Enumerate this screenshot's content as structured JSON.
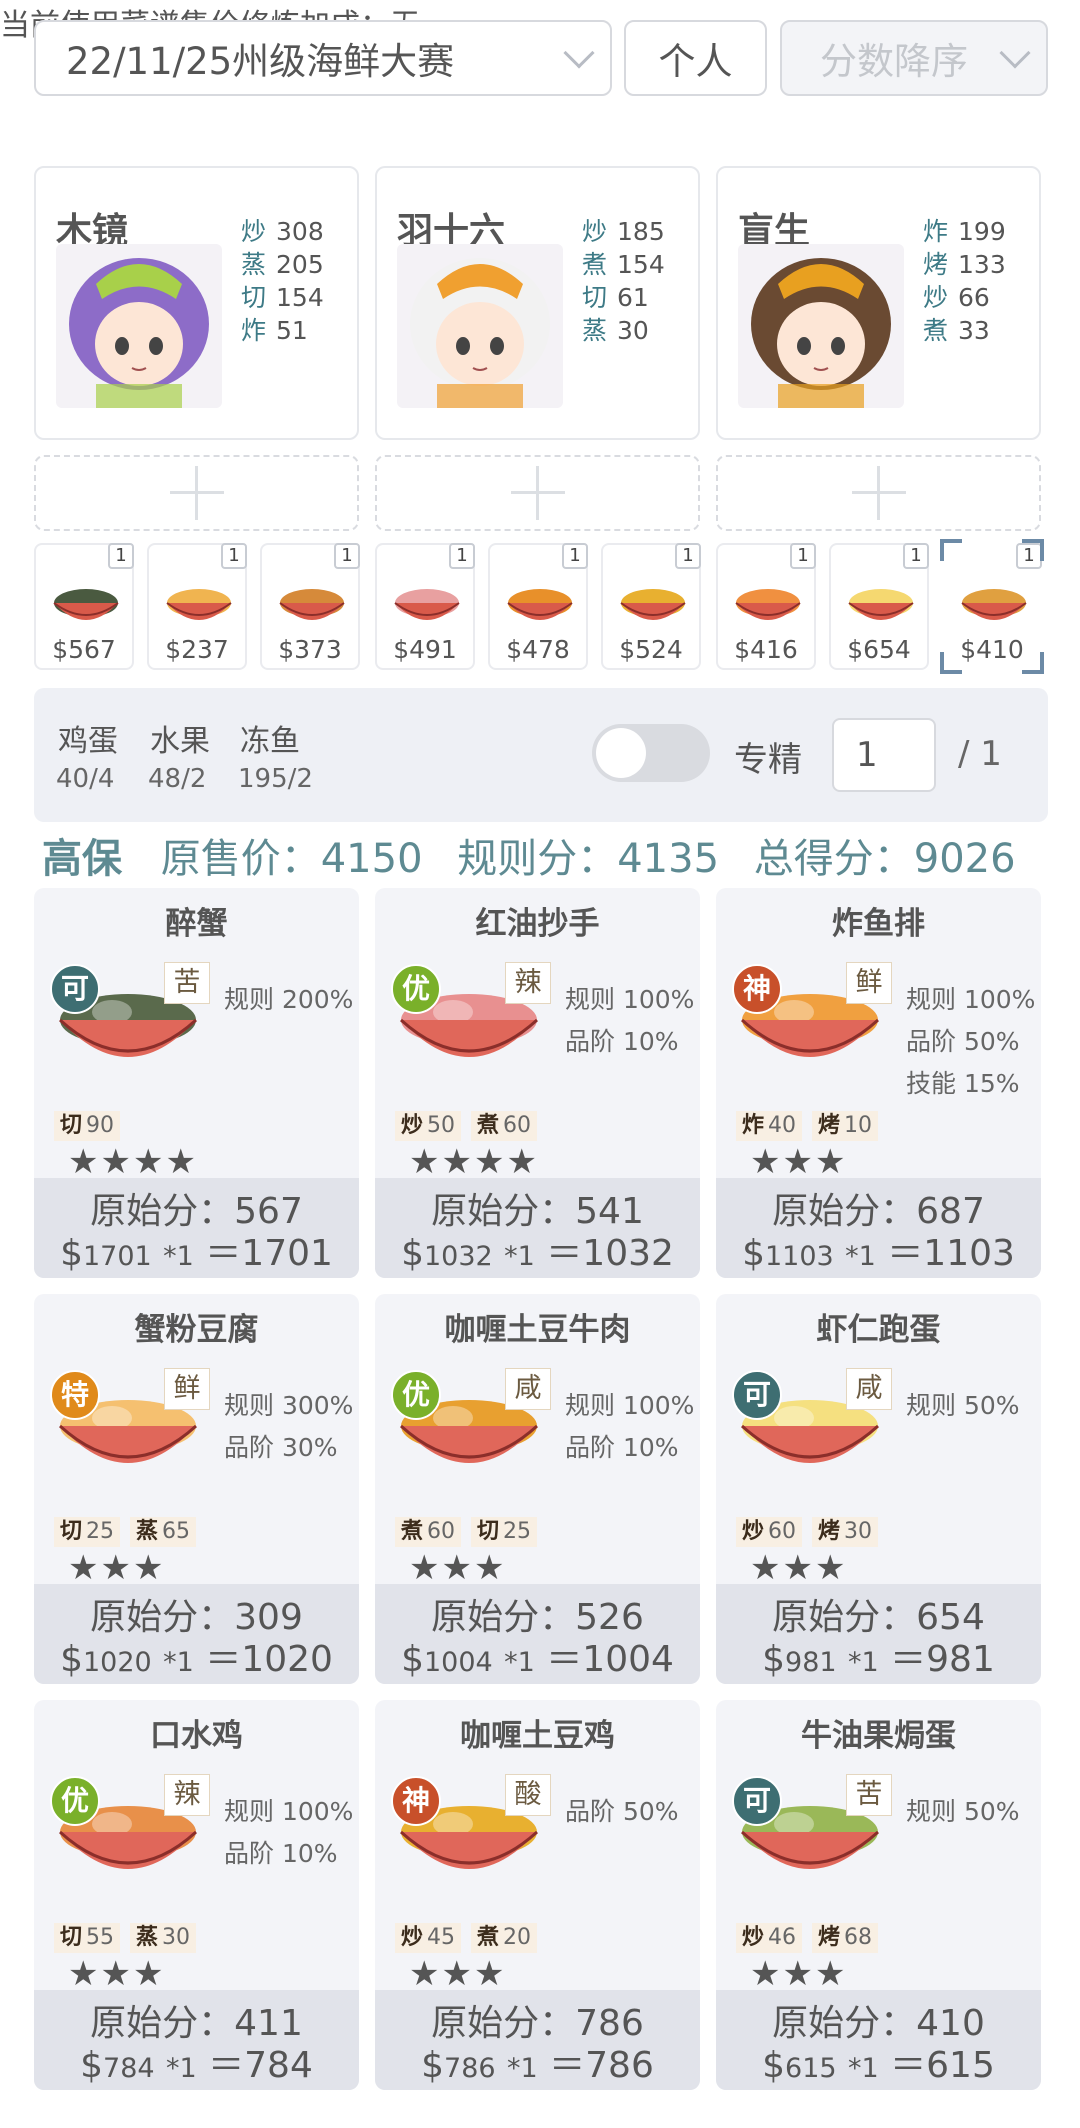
{
  "header": {
    "contest": "22/11/25州级海鲜大赛",
    "person_label": "个人",
    "sort_label": "分数降序",
    "bonus_text": "当前使用菜谱售价修炼加成：无"
  },
  "chefs": [
    {
      "name": "木镜",
      "skills": [
        {
          "k": "炒",
          "v": "308"
        },
        {
          "k": "蒸",
          "v": "205"
        },
        {
          "k": "切",
          "v": "154"
        },
        {
          "k": "炸",
          "v": "51"
        }
      ],
      "hair": "#8d6cc8",
      "accent": "#a8d04a"
    },
    {
      "name": "羽十六",
      "skills": [
        {
          "k": "炒",
          "v": "185"
        },
        {
          "k": "煮",
          "v": "154"
        },
        {
          "k": "切",
          "v": "61"
        },
        {
          "k": "蒸",
          "v": "30"
        }
      ],
      "hair": "#f2f2f2",
      "accent": "#f0a030"
    },
    {
      "name": "盲生",
      "skills": [
        {
          "k": "炸",
          "v": "199"
        },
        {
          "k": "烤",
          "v": "133"
        },
        {
          "k": "炒",
          "v": "66"
        },
        {
          "k": "煮",
          "v": "33"
        }
      ],
      "hair": "#6a4a32",
      "accent": "#e8a020"
    }
  ],
  "strip": [
    {
      "price": "$567",
      "qty": "1",
      "color": "#4a5a40"
    },
    {
      "price": "$237",
      "qty": "1",
      "color": "#f0b450"
    },
    {
      "price": "$373",
      "qty": "1",
      "color": "#d68a3a"
    },
    {
      "price": "$491",
      "qty": "1",
      "color": "#e8a0a0"
    },
    {
      "price": "$478",
      "qty": "1",
      "color": "#e8902a"
    },
    {
      "price": "$524",
      "qty": "1",
      "color": "#e8b030"
    },
    {
      "price": "$416",
      "qty": "1",
      "color": "#f09040"
    },
    {
      "price": "$654",
      "qty": "1",
      "color": "#f5d870"
    },
    {
      "price": "$410",
      "qty": "1",
      "color": "#e0a040"
    }
  ],
  "ingredients": [
    {
      "name": "鸡蛋",
      "value": "40/4"
    },
    {
      "name": "水果",
      "value": "48/2"
    },
    {
      "name": "冻鱼",
      "value": "195/2"
    }
  ],
  "spec": {
    "label": "专精",
    "value": "1",
    "total": "/ 1"
  },
  "score": {
    "level": "高保",
    "orig": "原售价：4150",
    "rule": "规则分：4135",
    "total": "总得分：9026"
  },
  "dishes": [
    {
      "title": "醉蟹",
      "grade": "可",
      "gcolor": "#3e6e72",
      "tag": "苦",
      "rules": [
        "规则 200%"
      ],
      "skills": [
        {
          "k": "切",
          "v": "90"
        }
      ],
      "stars": "★★★★",
      "raw": "原始分：567",
      "price": "1701",
      "mult": "*1",
      "total": "＝1701",
      "food": "#5a6a4c"
    },
    {
      "title": "红油抄手",
      "grade": "优",
      "gcolor": "#7ab02a",
      "tag": "辣",
      "rules": [
        "规则 100%",
        "品阶 10%"
      ],
      "skills": [
        {
          "k": "炒",
          "v": "50"
        },
        {
          "k": "煮",
          "v": "60"
        }
      ],
      "stars": "★★★★",
      "raw": "原始分：541",
      "price": "1032",
      "mult": "*1",
      "total": "＝1032",
      "food": "#e89090"
    },
    {
      "title": "炸鱼排",
      "grade": "神",
      "gcolor": "#c8502a",
      "tag": "鲜",
      "rules": [
        "规则 100%",
        "品阶 50%",
        "技能 15%"
      ],
      "skills": [
        {
          "k": "炸",
          "v": "40"
        },
        {
          "k": "烤",
          "v": "10"
        }
      ],
      "stars": "★★★",
      "raw": "原始分：687",
      "price": "1103",
      "mult": "*1",
      "total": "＝1103",
      "food": "#f0a040"
    },
    {
      "title": "蟹粉豆腐",
      "grade": "特",
      "gcolor": "#e08a1a",
      "tag": "鲜",
      "rules": [
        "规则 300%",
        "品阶 30%"
      ],
      "skills": [
        {
          "k": "切",
          "v": "25"
        },
        {
          "k": "蒸",
          "v": "65"
        }
      ],
      "stars": "★★★",
      "raw": "原始分：309",
      "price": "1020",
      "mult": "*1",
      "total": "＝1020",
      "food": "#f5c070"
    },
    {
      "title": "咖喱土豆牛肉",
      "grade": "优",
      "gcolor": "#7ab02a",
      "tag": "咸",
      "rules": [
        "规则 100%",
        "品阶 10%"
      ],
      "skills": [
        {
          "k": "煮",
          "v": "60"
        },
        {
          "k": "切",
          "v": "25"
        }
      ],
      "stars": "★★★",
      "raw": "原始分：526",
      "price": "1004",
      "mult": "*1",
      "total": "＝1004",
      "food": "#e8a030"
    },
    {
      "title": "虾仁跑蛋",
      "grade": "可",
      "gcolor": "#3e6e72",
      "tag": "咸",
      "rules": [
        "规则 50%"
      ],
      "skills": [
        {
          "k": "炒",
          "v": "60"
        },
        {
          "k": "烤",
          "v": "30"
        }
      ],
      "stars": "★★★",
      "raw": "原始分：654",
      "price": "981",
      "mult": "*1",
      "total": "＝981",
      "food": "#f5e080"
    },
    {
      "title": "口水鸡",
      "grade": "优",
      "gcolor": "#7ab02a",
      "tag": "辣",
      "rules": [
        "规则 100%",
        "品阶 10%"
      ],
      "skills": [
        {
          "k": "切",
          "v": "55"
        },
        {
          "k": "蒸",
          "v": "30"
        }
      ],
      "stars": "★★★",
      "raw": "原始分：411",
      "price": "784",
      "mult": "*1",
      "total": "＝784",
      "food": "#e8904a"
    },
    {
      "title": "咖喱土豆鸡",
      "grade": "神",
      "gcolor": "#c8502a",
      "tag": "酸",
      "rules": [
        "品阶 50%"
      ],
      "skills": [
        {
          "k": "炒",
          "v": "45"
        },
        {
          "k": "煮",
          "v": "20"
        }
      ],
      "stars": "★★★",
      "raw": "原始分：786",
      "price": "786",
      "mult": "*1",
      "total": "＝786",
      "food": "#e8b030"
    },
    {
      "title": "牛油果焗蛋",
      "grade": "可",
      "gcolor": "#3e6e72",
      "tag": "苦",
      "rules": [
        "规则 50%"
      ],
      "skills": [
        {
          "k": "炒",
          "v": "46"
        },
        {
          "k": "烤",
          "v": "68"
        }
      ],
      "stars": "★★★",
      "raw": "原始分：410",
      "price": "615",
      "mult": "*1",
      "total": "＝615",
      "food": "#9ab858"
    }
  ]
}
